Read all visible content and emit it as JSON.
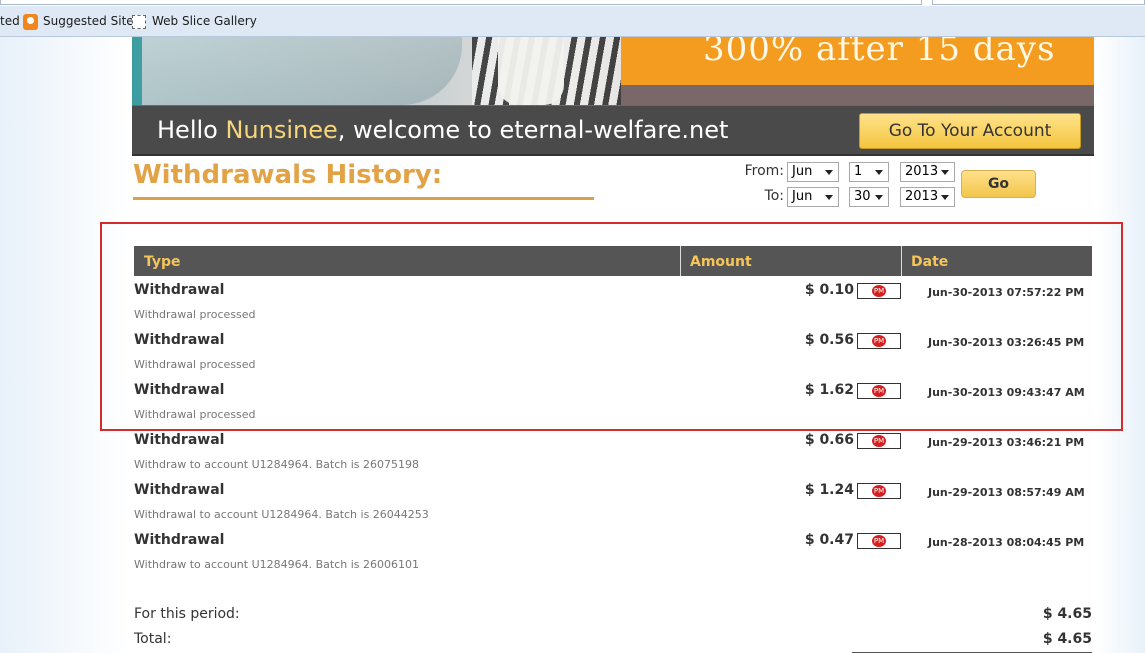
{
  "browser": {
    "favorites": [
      {
        "label": "ted"
      },
      {
        "label": "Suggested Sites",
        "icon": "suggested-sites-icon"
      },
      {
        "label": "Web Slice Gallery",
        "icon": "web-slice-icon"
      }
    ]
  },
  "banner": {
    "promo_text": "300% after 15 days"
  },
  "welcome": {
    "hello": "Hello ",
    "name": "Nunsinee",
    "rest": ", welcome to eternal-welfare.net",
    "account_button": "Go To Your Account"
  },
  "page_title": "Withdrawals History:",
  "filter": {
    "from_label": "From:",
    "to_label": "To:",
    "from": {
      "month": "Jun",
      "day": "1",
      "year": "2013"
    },
    "to": {
      "month": "Jun",
      "day": "30",
      "year": "2013"
    },
    "go_label": "Go"
  },
  "table": {
    "headers": [
      "Type",
      "Amount",
      "Date"
    ],
    "payment_icon_label": "PM",
    "rows": [
      {
        "type": "Withdrawal",
        "desc": "Withdrawal processed",
        "amount": "$ 0.10",
        "date": "Jun-30-2013 07:57:22 PM"
      },
      {
        "type": "Withdrawal",
        "desc": "Withdrawal processed",
        "amount": "$ 0.56",
        "date": "Jun-30-2013 03:26:45 PM"
      },
      {
        "type": "Withdrawal",
        "desc": "Withdrawal processed",
        "amount": "$ 1.62",
        "date": "Jun-30-2013 09:43:47 AM"
      },
      {
        "type": "Withdrawal",
        "desc": "Withdraw to account U1284964. Batch is 26075198",
        "amount": "$ 0.66",
        "date": "Jun-29-2013 03:46:21 PM"
      },
      {
        "type": "Withdrawal",
        "desc": "Withdrawal to account U1284964. Batch is 26044253",
        "amount": "$ 1.24",
        "date": "Jun-29-2013 08:57:49 AM"
      },
      {
        "type": "Withdrawal",
        "desc": "Withdraw to account U1284964. Batch is 26006101",
        "amount": "$ 0.47",
        "date": "Jun-28-2013 08:04:45 PM"
      }
    ]
  },
  "totals": {
    "period_label": "For this period:",
    "period_value": "$ 4.65",
    "total_label": "Total:",
    "total_value": "$ 4.65"
  },
  "colors": {
    "accent_orange": "#e2a246",
    "header_bg": "#555555",
    "header_text": "#f5c55a",
    "highlight_red": "#d42c2c",
    "button_yellow": "#f3c53f"
  }
}
